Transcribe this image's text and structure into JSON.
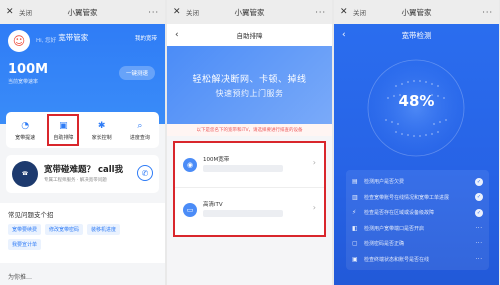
{
  "wechat_bar": {
    "close_label": "关闭",
    "title": "小翼管家"
  },
  "panel1": {
    "page_title": "宽带管家",
    "mine_label": "我的宽带",
    "greeting": "Hi, 您好",
    "speed": "100M",
    "speed_sub": "当前宽带速率",
    "speed_button": "一键测速",
    "menu": [
      {
        "label": "宽带提速",
        "icon": "speedometer-icon"
      },
      {
        "label": "自助排障",
        "icon": "toolbox-icon"
      },
      {
        "label": "家长控制",
        "icon": "shield-icon"
      },
      {
        "label": "进度查询",
        "icon": "magnifier-icon"
      }
    ],
    "banner_title": "宽带碰难题？ call我",
    "banner_sub": "专属工程师服务 · 解决宽带问题",
    "faq_title": "常见问题支个招",
    "faq_tags": [
      "宽带要续费",
      "修改宽带密码",
      "装移机进度",
      "我要宣计单"
    ],
    "footer_text": "为你推…"
  },
  "panel2": {
    "page_title": "自助排障",
    "hero_line1": "轻松解决断网、卡顿、掉线",
    "hero_line2": "快速预约上门服务",
    "notice": "以下是您名下的宽带和iTV，请选择要进行排查的设备",
    "lines": [
      {
        "name": "100M宽带",
        "icon": "globe-icon"
      },
      {
        "name": "高清iTV",
        "icon": "tv-icon"
      }
    ]
  },
  "panel3": {
    "page_title": "宽带检测",
    "percent": "48%",
    "checks": [
      {
        "label": "检测用户是否欠费",
        "status": "done"
      },
      {
        "label": "检查宽带账号在线情况和宽带工单进展",
        "status": "done"
      },
      {
        "label": "检查是否存在区域或设备级故障",
        "status": "done"
      },
      {
        "label": "检测用户宽带端口是否开启",
        "status": "pending"
      },
      {
        "label": "检测密码是否正确",
        "status": "pending"
      },
      {
        "label": "检查终端状态和账号是否在线",
        "status": "pending"
      }
    ]
  }
}
